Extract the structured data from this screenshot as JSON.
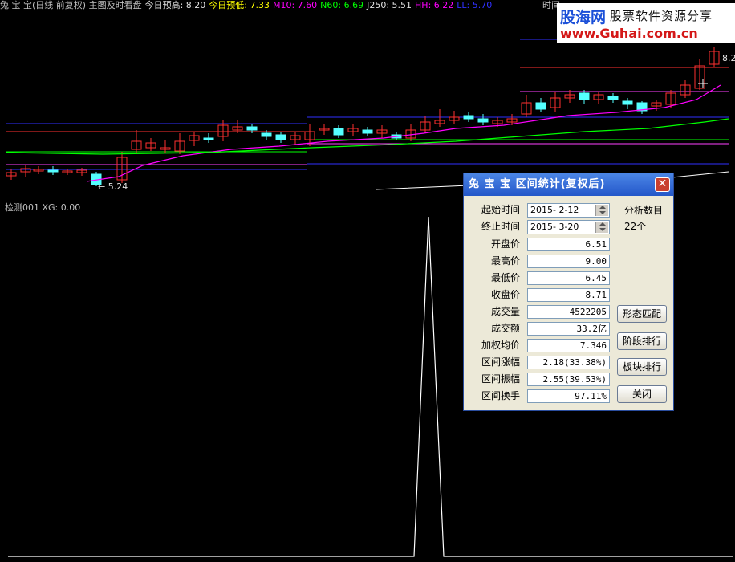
{
  "header": {
    "segments": [
      {
        "text": "兔 宝 宝(日线 前复权) 主图及时看盘",
        "color": "#c0c0c0"
      },
      {
        "text": "今日预高: 8.20",
        "color": "#e0e0e0"
      },
      {
        "text": "今日预低: 7.33",
        "color": "#ffff00"
      },
      {
        "text": "M10: 7.60",
        "color": "#ff00ff"
      },
      {
        "text": "N60: 6.69",
        "color": "#00ff00"
      },
      {
        "text": "J250: 5.51",
        "color": "#e0e0e0"
      },
      {
        "text": "HH: 6.22",
        "color": "#ff00ff"
      },
      {
        "text": "LL: 5.70",
        "color": "#3030ff"
      }
    ],
    "time_label": "时间"
  },
  "watermark": {
    "logo": "股海网",
    "tagline": "股票软件资源分享",
    "url": "www.Guhai.com.cn"
  },
  "chart": {
    "low_marker": "5.24",
    "high_marker": "8.2"
  },
  "indicator": {
    "label": "检测001  XG: 0.00"
  },
  "dialog": {
    "title": "兔 宝 宝  区间统计(复权后)",
    "close": "✕",
    "start_label": "起始时间",
    "start_value": "2015- 2-12",
    "end_label": "终止时间",
    "end_value": "2015- 3-20",
    "analysis_label": "分析数目",
    "analysis_count": "22个",
    "rows": [
      {
        "label": "开盘价",
        "value": "6.51"
      },
      {
        "label": "最高价",
        "value": "9.00"
      },
      {
        "label": "最低价",
        "value": "6.45"
      },
      {
        "label": "收盘价",
        "value": "8.71"
      },
      {
        "label": "成交量",
        "value": "4522205"
      },
      {
        "label": "成交额",
        "value": "33.2亿"
      },
      {
        "label": "加权均价",
        "value": "7.346"
      },
      {
        "label": "区间涨幅",
        "value": "2.18(33.38%)"
      },
      {
        "label": "区间振幅",
        "value": "2.55(39.53%)"
      },
      {
        "label": "区间换手",
        "value": "97.11%"
      }
    ],
    "buttons": {
      "pattern": "形态匹配",
      "stage_rank": "阶段排行",
      "sector_rank": "板块排行",
      "close": "关闭"
    }
  },
  "colors": {
    "up_candle": "#ff3030",
    "down_candle": "#54ffff",
    "ma_short": "#ff00ff",
    "ma_mid": "#00ff00",
    "ma_long": "#ffffff",
    "dialog_title": "#2457c9"
  }
}
